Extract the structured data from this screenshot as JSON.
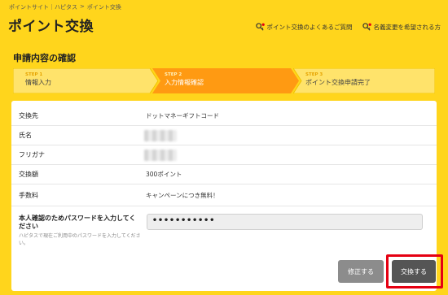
{
  "breadcrumb": {
    "items": [
      "ポイントサイト｜ハピタス",
      "ポイント交換"
    ],
    "separator": ">"
  },
  "page_title": "ポイント交換",
  "help_links": [
    {
      "label": "ポイント交換のよくあるご質問",
      "icon": "key-question-icon"
    },
    {
      "label": "名義変更を希望される方",
      "icon": "key-question-icon"
    }
  ],
  "section_title": "申請内容の確認",
  "steps": [
    {
      "number": "STEP 1",
      "label": "情報入力",
      "state": "inactive"
    },
    {
      "number": "STEP 2",
      "label": "入力情報確認",
      "state": "active"
    },
    {
      "number": "STEP 3",
      "label": "ポイント交換申請完了",
      "state": "inactive"
    }
  ],
  "form": {
    "rows": [
      {
        "label": "交換先",
        "value": "ドットマネーギフトコード"
      },
      {
        "label": "氏名",
        "value": ""
      },
      {
        "label": "フリガナ",
        "value": ""
      },
      {
        "label": "交換額",
        "value": "300ポイント"
      },
      {
        "label": "手数料",
        "value": "キャンペーンにつき無料！"
      }
    ],
    "password": {
      "label": "本人確認のためパスワードを入力してください",
      "hint": "ハピタスで現在ご利用中のパスワードを入力してください。",
      "value": "•••••••••••"
    }
  },
  "buttons": {
    "edit": "修正する",
    "exchange": "交換する"
  },
  "colors": {
    "background": "#ffd51c",
    "step_active": "#ff9a12",
    "step_inactive": "#ffe36b",
    "highlight": "#e50012"
  }
}
